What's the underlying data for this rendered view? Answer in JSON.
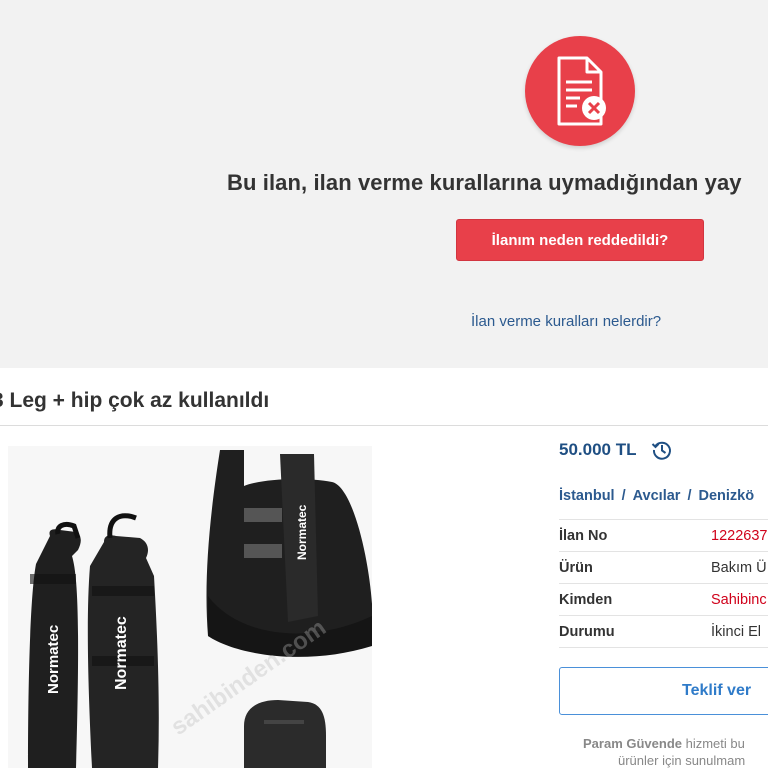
{
  "banner": {
    "message": "Bu ilan, ilan verme kurallarına uymadığından yay",
    "why_button": "İlanım neden reddedildi?",
    "rules_link": "İlan verme kuralları nelerdir?",
    "icon": "document-reject-icon",
    "accent_color": "#e8404a"
  },
  "listing": {
    "title": "3 Leg + hip çok az kullanıldı",
    "price": "50.000 TL",
    "price_history_icon": "history-icon",
    "breadcrumb": [
      "İstanbul",
      "Avcılar",
      "Denizkö"
    ],
    "details": [
      {
        "label": "İlan No",
        "value": "1222637",
        "highlight": true
      },
      {
        "label": "Ürün",
        "value": "Bakım Ü",
        "highlight": false
      },
      {
        "label": "Kimden",
        "value": "Sahibinc",
        "highlight": true
      },
      {
        "label": "Durumu",
        "value": "İkinci El",
        "highlight": false
      }
    ],
    "offer_button": "Teklif ver",
    "safe_note": {
      "brand": "Param Güvende",
      "line1_rest": " hizmeti bu",
      "line2": "ürünler için sunulmam"
    },
    "photo": {
      "brand_text": "Normatec",
      "watermark": "sahibinden.com"
    }
  }
}
